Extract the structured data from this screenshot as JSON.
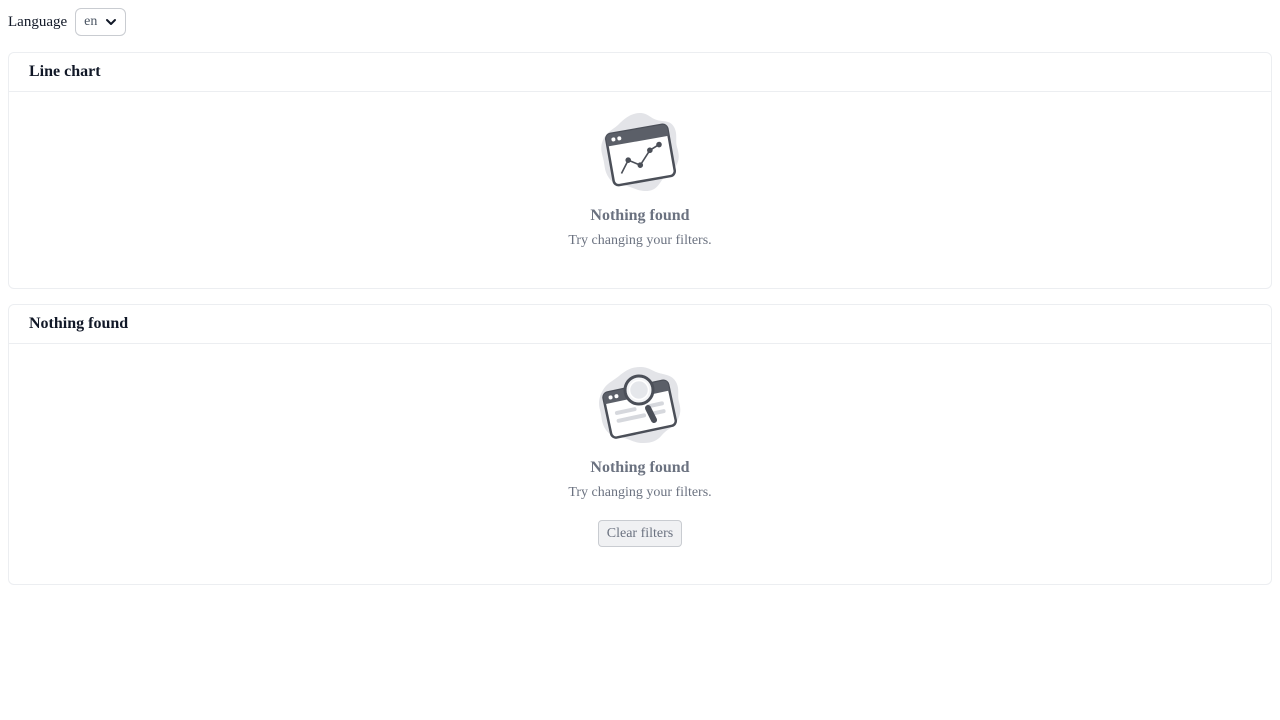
{
  "language": {
    "label": "Language",
    "selected": "en"
  },
  "line_chart_card": {
    "title": "Line chart",
    "empty_state": {
      "icon": "line-chart-window-icon",
      "title": "Nothing found",
      "description": "Try changing your filters."
    }
  },
  "nothing_found_card": {
    "title": "Nothing found",
    "empty_state": {
      "icon": "search-magnifier-window-icon",
      "title": "Nothing found",
      "description": "Try changing your filters.",
      "button_label": "Clear filters"
    }
  }
}
